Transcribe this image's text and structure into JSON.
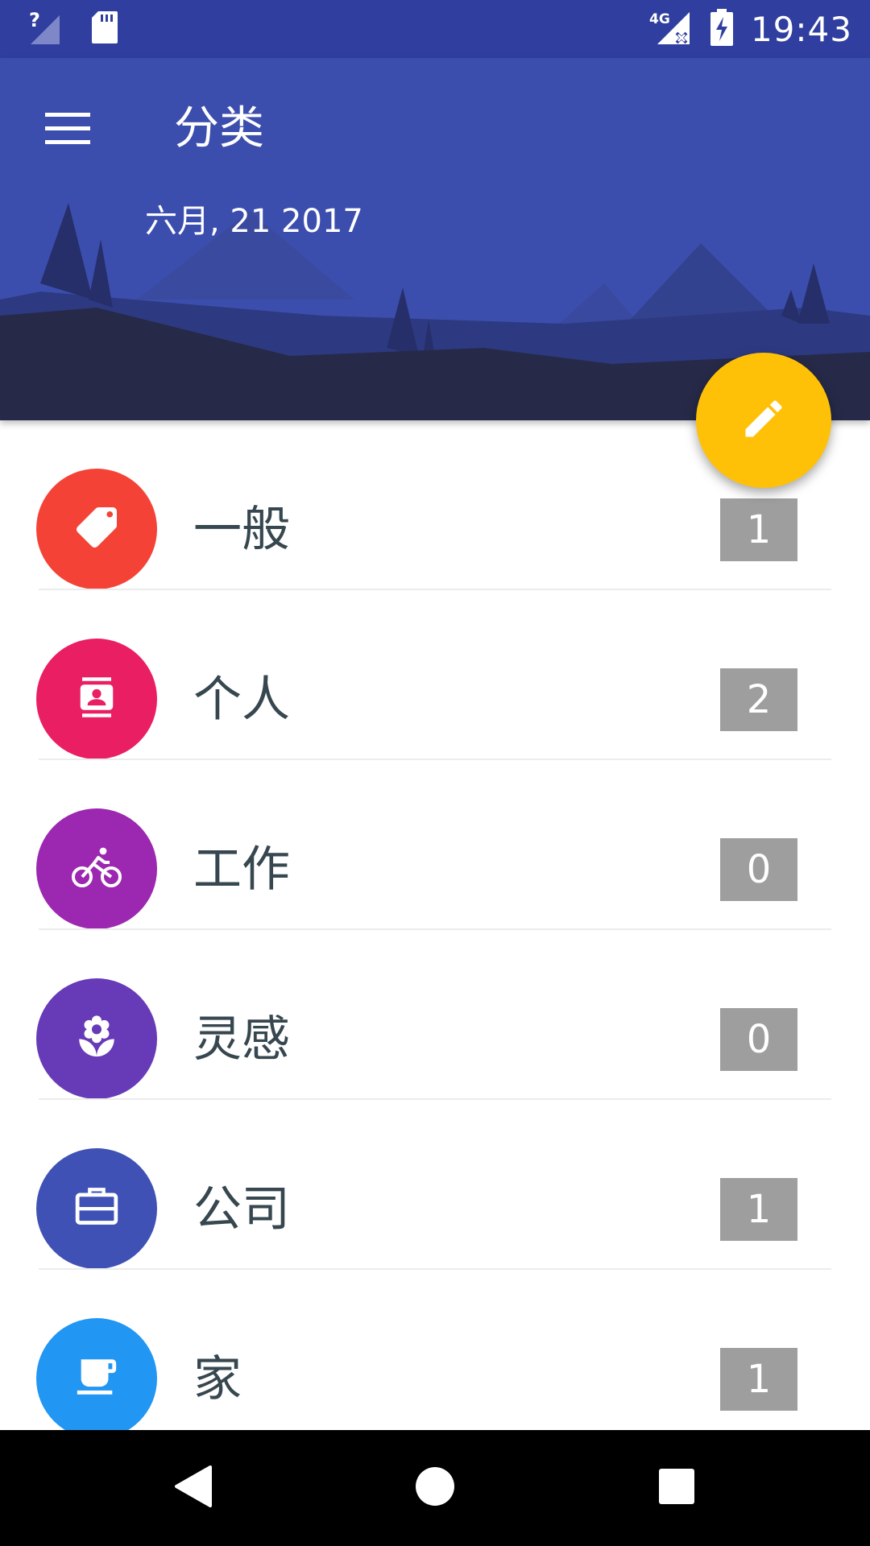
{
  "status_bar": {
    "time": "19:43",
    "network": "4G",
    "icons": [
      "signal-unknown-icon",
      "sd-card-icon",
      "signal-4g-no-data-icon",
      "battery-charging-icon"
    ]
  },
  "header": {
    "title": "分类",
    "date": "六月, 21 2017",
    "menu_icon": "hamburger-menu-icon",
    "colors": {
      "primary": "#3c4ead",
      "primary_dark": "#303f9f"
    }
  },
  "fab": {
    "icon": "pencil-icon",
    "color": "#ffc107"
  },
  "categories": [
    {
      "label": "一般",
      "count": "1",
      "icon": "tag-icon",
      "color": "#f44336"
    },
    {
      "label": "个人",
      "count": "2",
      "icon": "contact-card-icon",
      "color": "#e91e63"
    },
    {
      "label": "工作",
      "count": "0",
      "icon": "bicycle-icon",
      "color": "#9c27b0"
    },
    {
      "label": "灵感",
      "count": "0",
      "icon": "flower-icon",
      "color": "#673ab7"
    },
    {
      "label": "公司",
      "count": "1",
      "icon": "briefcase-icon",
      "color": "#3f51b5"
    },
    {
      "label": "家",
      "count": "1",
      "icon": "coffee-cup-icon",
      "color": "#2196f3"
    }
  ],
  "nav_bar": {
    "buttons": [
      "back-icon",
      "home-icon",
      "recents-icon"
    ]
  }
}
